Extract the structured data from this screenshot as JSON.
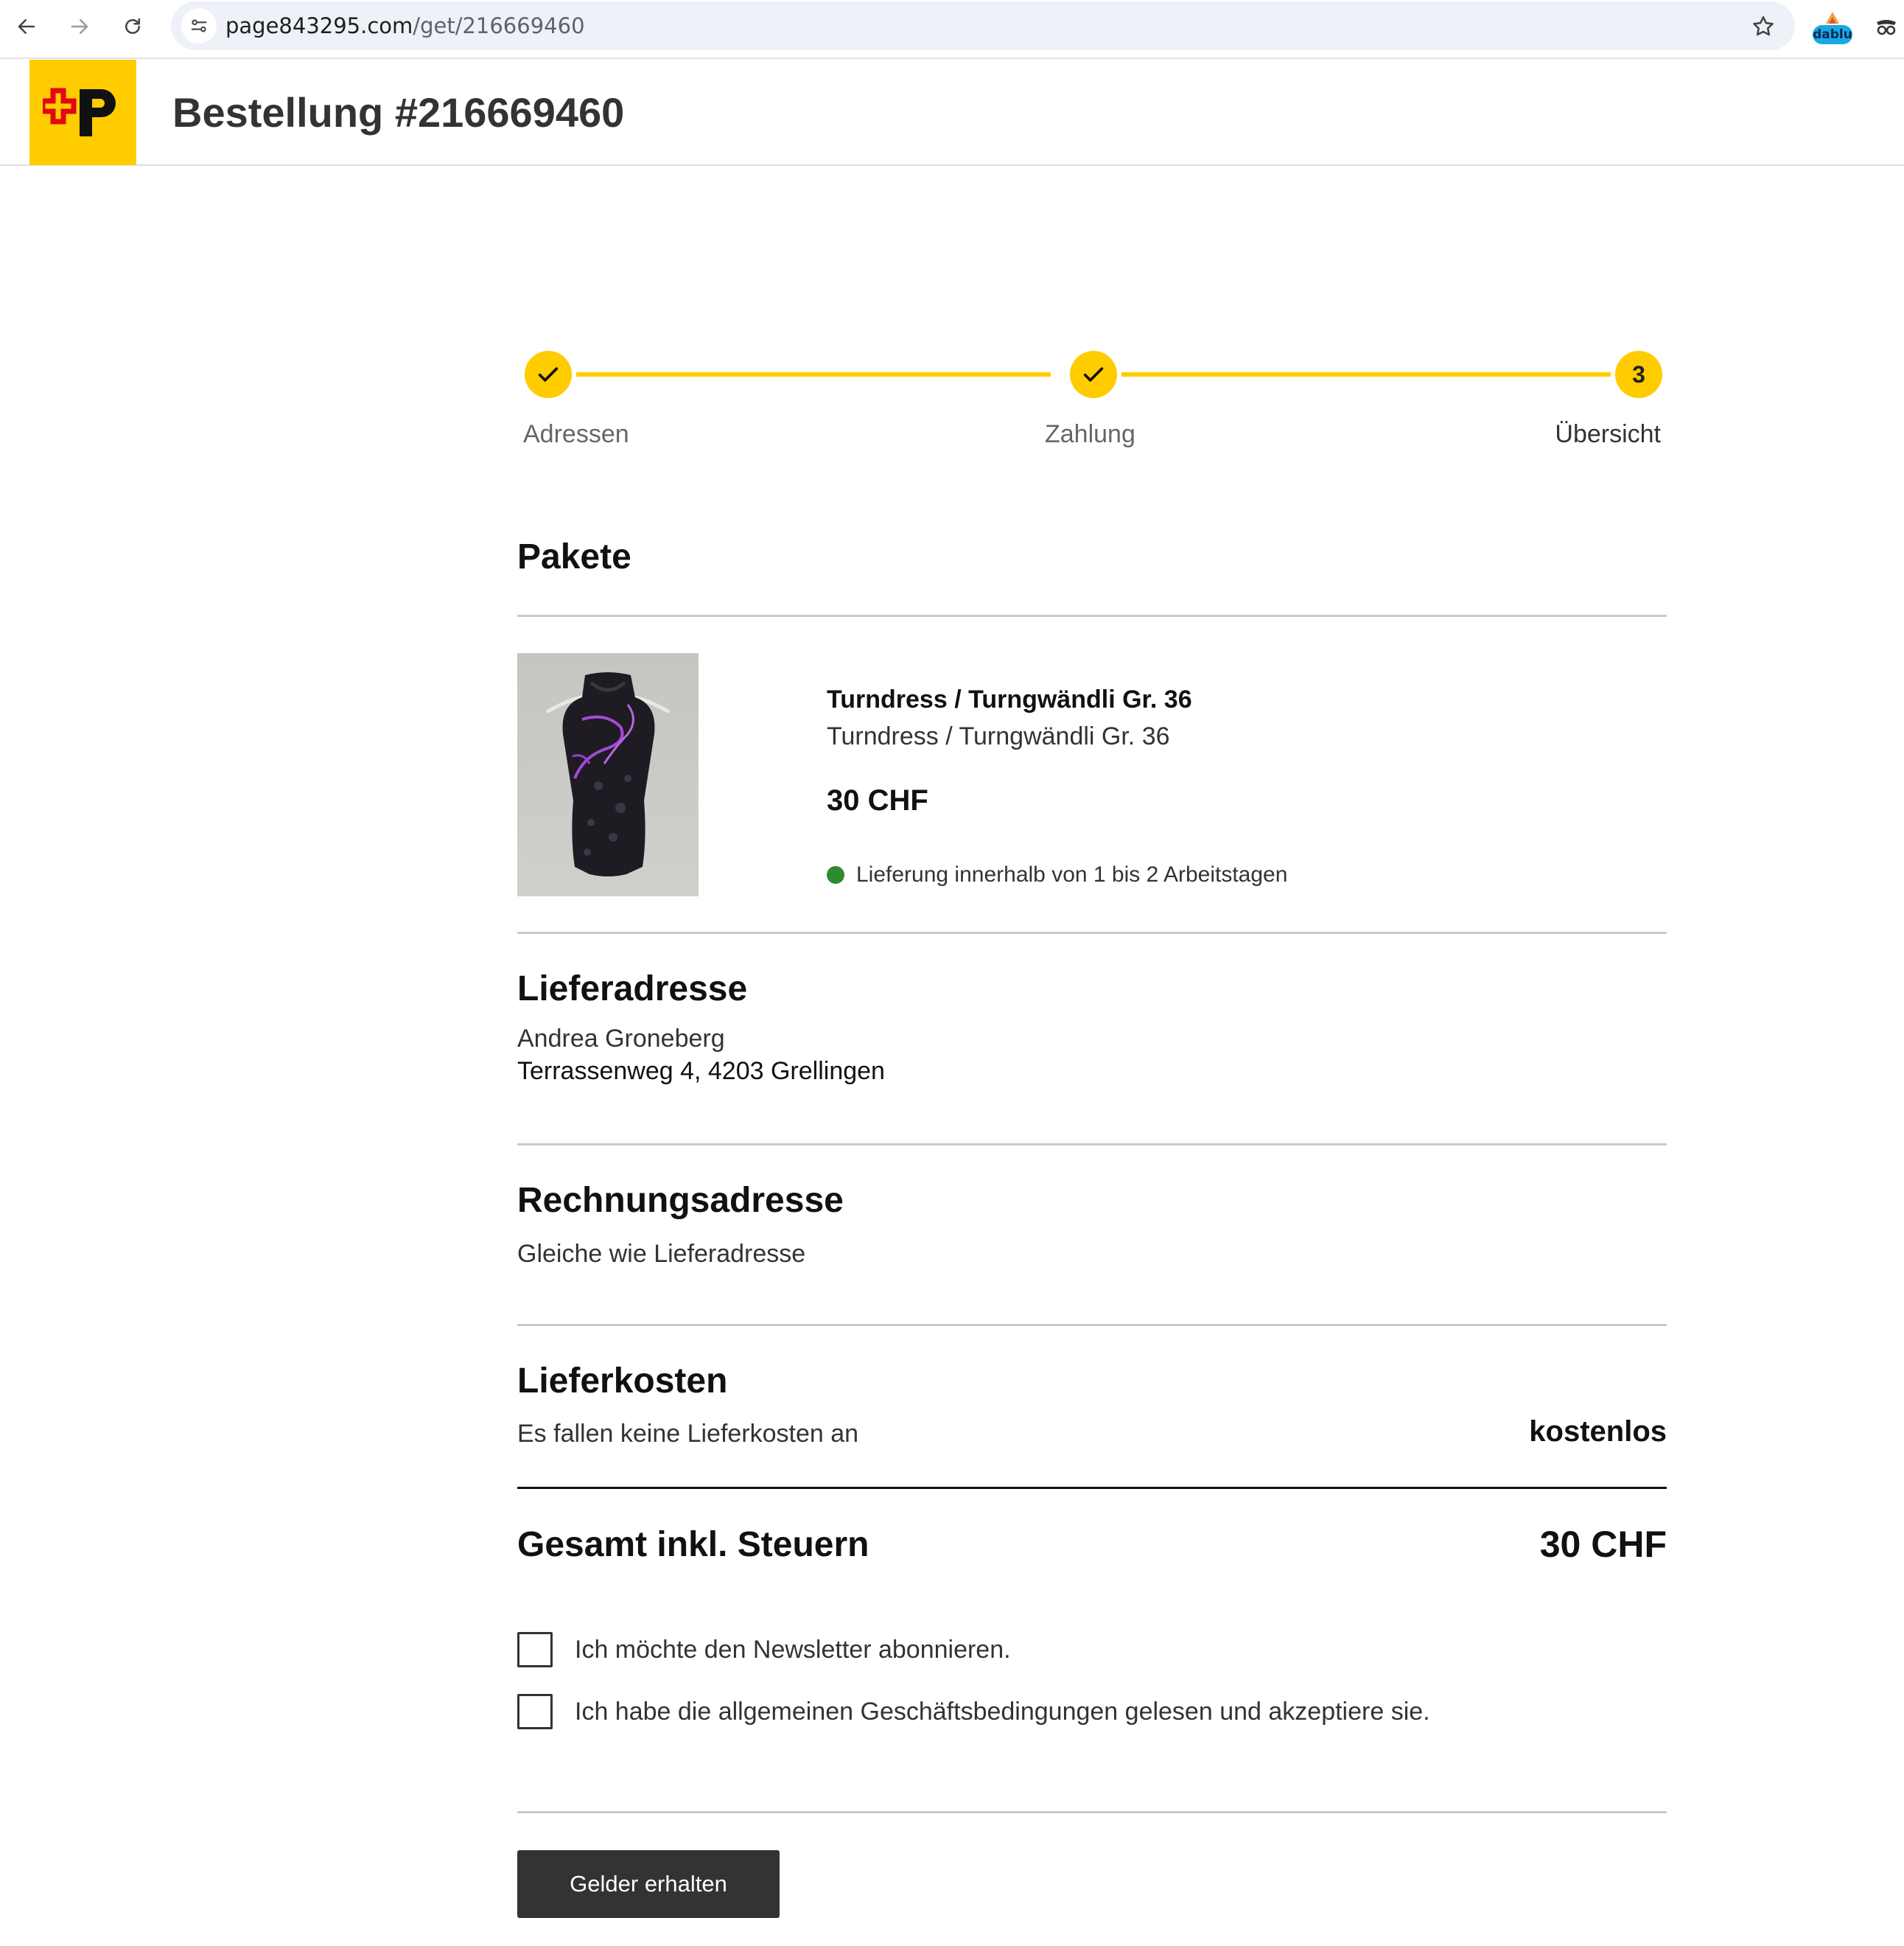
{
  "browser": {
    "url_host": "page843295.com",
    "url_path": "/get/216669460",
    "extension_badge": "dablu"
  },
  "header": {
    "title": "Bestellung #216669460"
  },
  "stepper": {
    "steps": [
      {
        "label": "Adressen",
        "status": "done"
      },
      {
        "label": "Zahlung",
        "status": "done"
      },
      {
        "label": "Übersicht",
        "number": "3",
        "status": "active"
      }
    ]
  },
  "packages": {
    "heading": "Pakete",
    "item": {
      "name": "Turndress / Turngwändli Gr. 36",
      "description": "Turndress / Turngwändli Gr. 36",
      "price": "30 CHF",
      "delivery": "Lieferung innerhalb von 1 bis 2 Arbeitstagen"
    }
  },
  "shipping_address": {
    "heading": "Lieferadresse",
    "name": "Andrea Groneberg",
    "street": "Terrassenweg 4, 4203 Grellingen"
  },
  "billing_address": {
    "heading": "Rechnungsadresse",
    "text": "Gleiche wie Lieferadresse"
  },
  "shipping_costs": {
    "heading": "Lieferkosten",
    "text": "Es fallen keine Lieferkosten an",
    "value": "kostenlos"
  },
  "total": {
    "label": "Gesamt inkl. Steuern",
    "value": "30 CHF"
  },
  "checkboxes": {
    "newsletter": "Ich möchte den Newsletter abonnieren.",
    "terms": "Ich habe die allgemeinen Geschäftsbedingungen gelesen und akzeptiere sie."
  },
  "submit": {
    "label": "Gelder erhalten"
  },
  "colors": {
    "brand_yellow": "#ffcc00",
    "button_dark": "#333333",
    "status_green": "#2e8b2e",
    "logo_red": "#e30613"
  }
}
